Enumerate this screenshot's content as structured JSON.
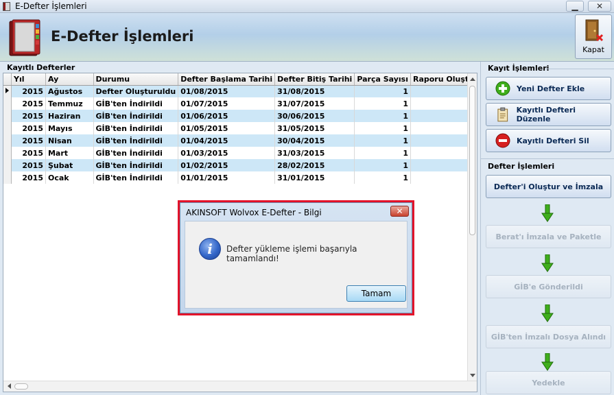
{
  "window": {
    "title": "E-Defter İşlemleri",
    "minimize_label": "▁",
    "close_label": "✕"
  },
  "header": {
    "title": "E-Defter İşlemleri",
    "close_button_label": "Kapat"
  },
  "grid": {
    "group_title": "Kayıtlı Defterler",
    "columns": [
      "Yıl",
      "Ay",
      "Durumu",
      "Defter Başlama Tarihi",
      "Defter Bitiş Tarihi",
      "Parça Sayısı",
      "Raporu Oluştu"
    ],
    "rows": [
      [
        "2015",
        "Ağustos",
        "Defter Oluşturuldu",
        "01/08/2015",
        "31/08/2015",
        "1",
        ""
      ],
      [
        "2015",
        "Temmuz",
        "GİB'ten İndirildi",
        "01/07/2015",
        "31/07/2015",
        "1",
        ""
      ],
      [
        "2015",
        "Haziran",
        "GİB'ten İndirildi",
        "01/06/2015",
        "30/06/2015",
        "1",
        ""
      ],
      [
        "2015",
        "Mayıs",
        "GİB'ten İndirildi",
        "01/05/2015",
        "31/05/2015",
        "1",
        ""
      ],
      [
        "2015",
        "Nisan",
        "GİB'ten İndirildi",
        "01/04/2015",
        "30/04/2015",
        "1",
        ""
      ],
      [
        "2015",
        "Mart",
        "GİB'ten İndirildi",
        "01/03/2015",
        "31/03/2015",
        "1",
        ""
      ],
      [
        "2015",
        "Şubat",
        "GİB'ten İndirildi",
        "01/02/2015",
        "28/02/2015",
        "1",
        ""
      ],
      [
        "2015",
        "Ocak",
        "GİB'ten İndirildi",
        "01/01/2015",
        "31/01/2015",
        "1",
        ""
      ]
    ],
    "selected_row": 0
  },
  "record_ops": {
    "title": "Kayıt İşlemleri",
    "buttons": [
      {
        "label": "Yeni Defter Ekle",
        "icon": "add-icon"
      },
      {
        "label": "Kayıtlı Defteri Düzenle",
        "icon": "edit-clipboard-icon"
      },
      {
        "label": "Kayıtlı Defteri Sil",
        "icon": "delete-icon"
      }
    ]
  },
  "ledger_ops": {
    "title": "Defter İşlemleri",
    "steps": [
      {
        "label": "Defter'i Oluştur ve İmzala",
        "enabled": true
      },
      {
        "label": "Berat'ı İmzala ve Paketle",
        "enabled": false
      },
      {
        "label": "GİB'e Gönderildi",
        "enabled": false
      },
      {
        "label": "GİB'ten İmzalı Dosya Alındı",
        "enabled": false
      },
      {
        "label": "Yedekle",
        "enabled": false
      }
    ]
  },
  "dialog": {
    "title": "AKINSOFT Wolvox E-Defter - Bilgi",
    "message": "Defter yükleme işlemi başarıyla tamamlandı!",
    "ok_label": "Tamam",
    "close_label": "✕",
    "icon": "info-icon"
  },
  "colors": {
    "alt_row": "#cde7f7",
    "highlight_border": "#e3132a",
    "arrow_green": "#3fae1c"
  }
}
